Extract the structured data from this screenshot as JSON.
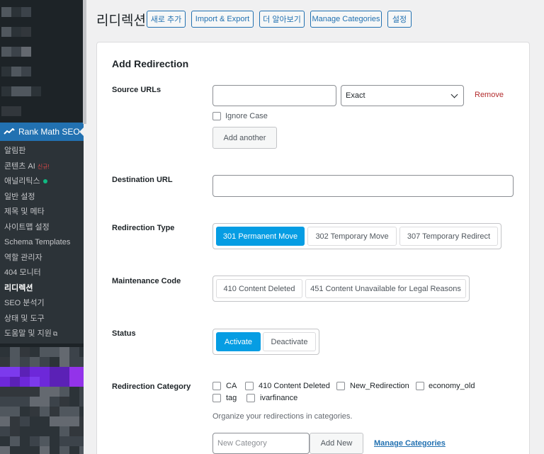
{
  "sidebar": {
    "active_menu": "Rank Math SEO",
    "submenu": [
      {
        "label": "알림판",
        "current": false
      },
      {
        "label": "콘텐츠 AI",
        "badge": "신규!",
        "current": false
      },
      {
        "label": "애널리틱스",
        "dot": true,
        "current": false
      },
      {
        "label": "일반 설정",
        "current": false
      },
      {
        "label": "제목 및 메타",
        "current": false
      },
      {
        "label": "사이트맵 설정",
        "current": false
      },
      {
        "label": "Schema Templates",
        "current": false
      },
      {
        "label": "역할 관리자",
        "current": false
      },
      {
        "label": "404 모니터",
        "current": false
      },
      {
        "label": "리디렉션",
        "current": true
      },
      {
        "label": "SEO 분석기",
        "current": false
      },
      {
        "label": "상태 및 도구",
        "current": false
      },
      {
        "label": "도움말 및 지원",
        "external": true,
        "current": false
      }
    ]
  },
  "header": {
    "title": "리디렉션",
    "buttons": [
      "새로 추가",
      "Import & Export",
      "더 알아보기",
      "Manage Categories",
      "설정"
    ]
  },
  "form": {
    "title": "Add Redirection",
    "source": {
      "label": "Source URLs",
      "value": "",
      "match_type": "Exact",
      "remove_label": "Remove",
      "ignore_case_label": "Ignore Case",
      "ignore_case_checked": false,
      "add_another_label": "Add another"
    },
    "destination": {
      "label": "Destination URL",
      "value": ""
    },
    "redirection_type": {
      "label": "Redirection Type",
      "options": [
        "301 Permanent Move",
        "302 Temporary Move",
        "307 Temporary Redirect"
      ],
      "selected": "301 Permanent Move"
    },
    "maintenance_code": {
      "label": "Maintenance Code",
      "options": [
        "410 Content Deleted",
        "451 Content Unavailable for Legal Reasons"
      ]
    },
    "status": {
      "label": "Status",
      "options": [
        "Activate",
        "Deactivate"
      ],
      "selected": "Activate"
    },
    "category": {
      "label": "Redirection Category",
      "items": [
        "CA",
        "410 Content Deleted",
        "New_Redirection",
        "economy_old",
        "tag",
        "ivarfinance"
      ],
      "hint": "Organize your redirections in categories.",
      "new_placeholder": "New Category",
      "add_new_label": "Add New",
      "manage_label": "Manage Categories"
    }
  },
  "colors": {
    "accent": "#2271b1",
    "active_toggle": "#069de3",
    "remove": "#b32d2e",
    "sidebar_bg": "#1d2327"
  }
}
